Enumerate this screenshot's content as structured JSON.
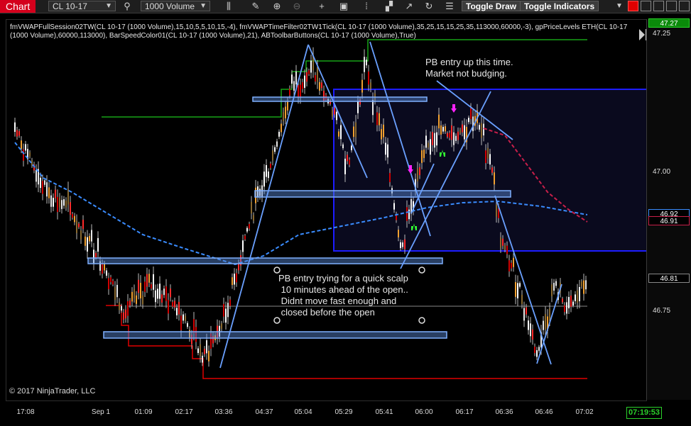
{
  "toolbar": {
    "tab": "Chart",
    "instrument": "CL 10-17",
    "bar_type": "1000 Volume",
    "toggle_draw": "Toggle Draw",
    "toggle_indicators": "Toggle Indicators"
  },
  "indicators_line": "fmVWAPFullSession02TW(CL 10-17 (1000 Volume),15,10,5,5,10,15,-4), fmVWAPTimeFilter02TW1Tick(CL 10-17 (1000 Volume),35,25,15,15,25,35,113000,60000,-3), gpPriceLevels ETH(CL 10-17 (1000 Volume),60000,113000), BarSpeedColor01(CL 10-17 (1000 Volume),21), ABToolbarButtons(CL 10-17 (1000 Volume),True)",
  "copyright": "© 2017 NinjaTrader, LLC",
  "annotations": {
    "note1": "PB entry up this time.\nMarket not budging.",
    "note2": "PB entry trying for a quick scalp\n 10 minutes ahead of the open..\n Didnt move fast enough and\n closed before the open"
  },
  "y_axis": {
    "ticks": [
      "47.25",
      "47.00",
      "46.75"
    ],
    "markers": {
      "last_high": "47.27",
      "vwap_a": "46.92",
      "vwap_b": "46.91",
      "last_price": "46.81"
    }
  },
  "x_axis": {
    "ticks": [
      "17:08",
      "Sep 1",
      "01:09",
      "02:17",
      "03:36",
      "04:37",
      "05:04",
      "05:29",
      "05:41",
      "06:00",
      "06:17",
      "06:36",
      "06:46",
      "07:02"
    ]
  },
  "clock": "07:19:53",
  "colors": {
    "accent_red": "#d4001c",
    "vwap_blue": "#3a8cff",
    "level_green": "#17a317",
    "level_red": "#e00000",
    "zone_box": "#1d1dff",
    "clock_green": "#2ad12a"
  }
}
